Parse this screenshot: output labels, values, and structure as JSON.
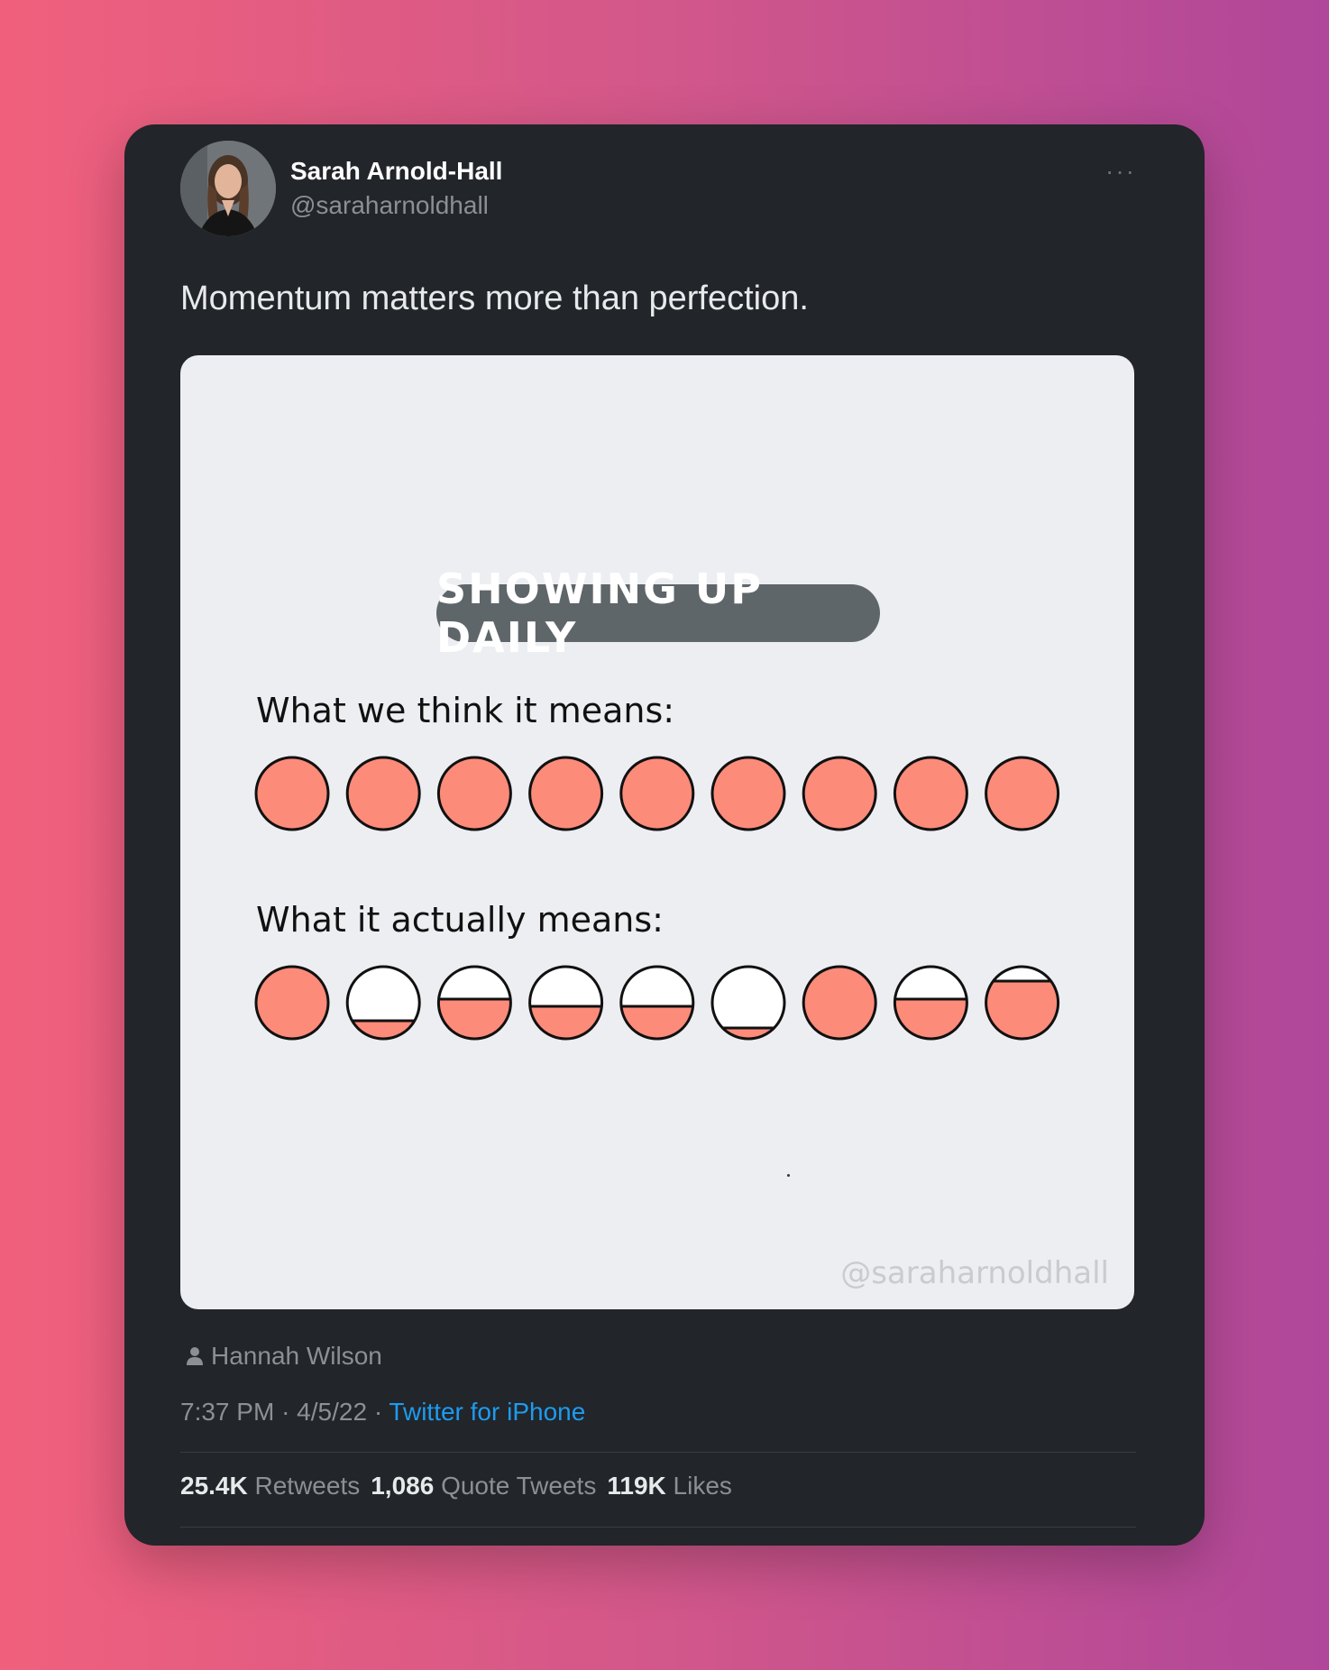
{
  "tweet": {
    "author_name": "Sarah Arnold-Hall",
    "author_handle": "@saraharnoldhall",
    "more_label": "···",
    "text": "Momentum matters more than perfection.",
    "tagged_user": "Hannah Wilson",
    "time": "7:37 PM",
    "date": "4/5/22",
    "separator": "·",
    "source": "Twitter for iPhone",
    "stats": {
      "retweets_count": "25.4K",
      "retweets_label": "Retweets",
      "quotes_count": "1,086",
      "quotes_label": "Quote Tweets",
      "likes_count": "119K",
      "likes_label": "Likes"
    }
  },
  "illustration": {
    "title": "SHOWING UP DAILY",
    "row1_label": "What we think it means:",
    "row2_label": "What it actually means:",
    "watermark": "@saraharnoldhall",
    "fill_color": "#fd8b7a",
    "row1_fill_levels": [
      1,
      1,
      1,
      1,
      1,
      1,
      1,
      1,
      1
    ],
    "row2_fill_levels": [
      1,
      0.25,
      0.55,
      0.45,
      0.45,
      0.15,
      1,
      0.55,
      0.8
    ]
  },
  "icons": {
    "person": "person-icon",
    "more": "more-icon"
  }
}
